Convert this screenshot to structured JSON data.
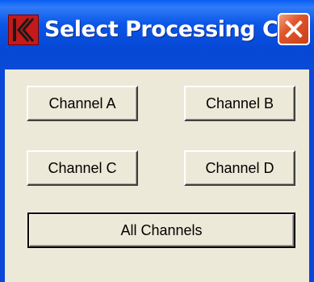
{
  "window": {
    "title": "Select Processing Ch",
    "icon": "app-logo-icon",
    "close_icon": "close-icon"
  },
  "buttons": {
    "channel_a": "Channel A",
    "channel_b": "Channel B",
    "channel_c": "Channel C",
    "channel_d": "Channel D",
    "all_channels": "All Channels"
  },
  "colors": {
    "titlebar": "#0548d4",
    "client_bg": "#ece9d8",
    "icon_red": "#c41a1a",
    "close_red": "#e0552a"
  }
}
